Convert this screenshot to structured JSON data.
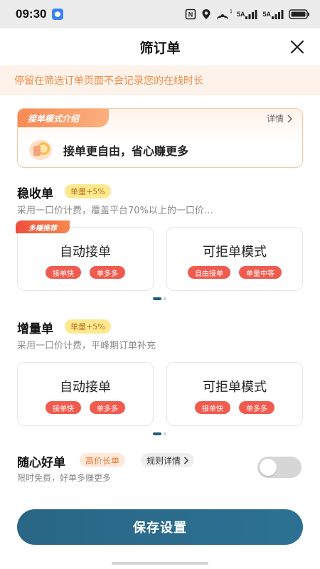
{
  "status_bar": {
    "time": "09:30",
    "badge_icon": "shield-icon",
    "net1": "5A",
    "net2": "5A",
    "signal_sup": "1"
  },
  "header": {
    "title": "筛订单",
    "close_icon": "close-icon"
  },
  "notice": {
    "text": "停留在筛选订单页面不会记录您的在线时长"
  },
  "intro": {
    "ribbon": "接单模式介绍",
    "detail": "详情",
    "slogan": "接单更自由，省心赚更多"
  },
  "sections": [
    {
      "title": "稳收单",
      "badge": "单量+5%",
      "desc": "采用一口价计费，覆盖平台70%以上的一口价…",
      "recommend_ribbon": "多赚推荐",
      "cards": [
        {
          "name": "自动接单",
          "tags": [
            "接单快",
            "单多多"
          ]
        },
        {
          "name": "可拒单模式",
          "tags": [
            "自由接单",
            "单量中等"
          ]
        }
      ]
    },
    {
      "title": "增量单",
      "badge": "单量+5%",
      "desc": "采用一口价计费，平峰期订单补充",
      "cards": [
        {
          "name": "自动接单",
          "tags": [
            "接单快",
            "单多多"
          ]
        },
        {
          "name": "可拒单模式",
          "tags": [
            "接单快",
            "单多多"
          ]
        }
      ]
    }
  ],
  "suixin": {
    "title": "随心好单",
    "badge": "高价长单",
    "rules": "规则详情",
    "desc": "限时免费，好单多赚更多",
    "enabled": false
  },
  "save_button": "保存设置",
  "colors": {
    "accent": "#2a6685",
    "tag_red": "#f05b4f",
    "notice_orange": "#ef8a4a"
  }
}
